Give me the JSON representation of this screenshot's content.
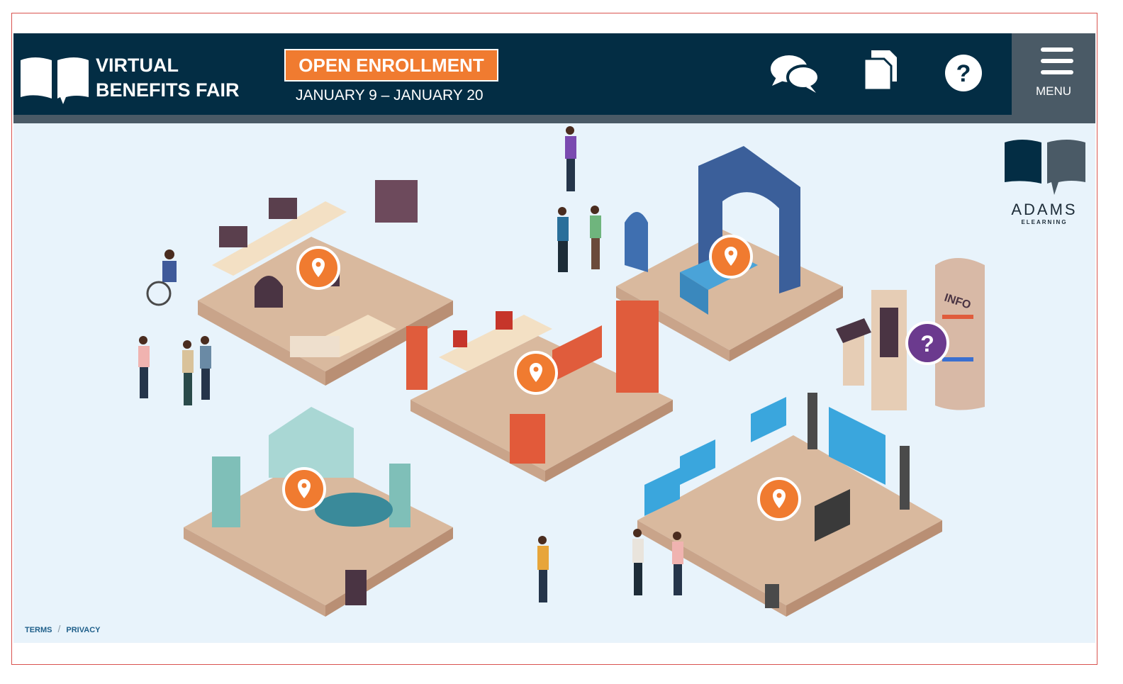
{
  "header": {
    "brand_line1": "VIRTUAL",
    "brand_line2": "BENEFITS FAIR",
    "enrollment_label": "OPEN ENROLLMENT",
    "enrollment_dates": "JANUARY 9 – JANUARY 20",
    "icons": [
      "chat-icon",
      "documents-icon",
      "help-icon"
    ],
    "menu_label": "MENU"
  },
  "scene": {
    "booth_pins": [
      "location-pin-icon",
      "location-pin-icon",
      "location-pin-icon",
      "location-pin-icon",
      "location-pin-icon"
    ],
    "info_sign_text": "INFO",
    "info_pin": "question-icon"
  },
  "sponsor": {
    "name": "ADAMS",
    "sub": "ELEARNING"
  },
  "footer": {
    "terms": "TERMS",
    "separator": "/",
    "privacy": "PRIVACY"
  },
  "colors": {
    "header_bg": "#032d44",
    "accent_orange": "#f07b30",
    "info_purple": "#6b3a8e",
    "scene_bg": "#e8f3fb"
  }
}
